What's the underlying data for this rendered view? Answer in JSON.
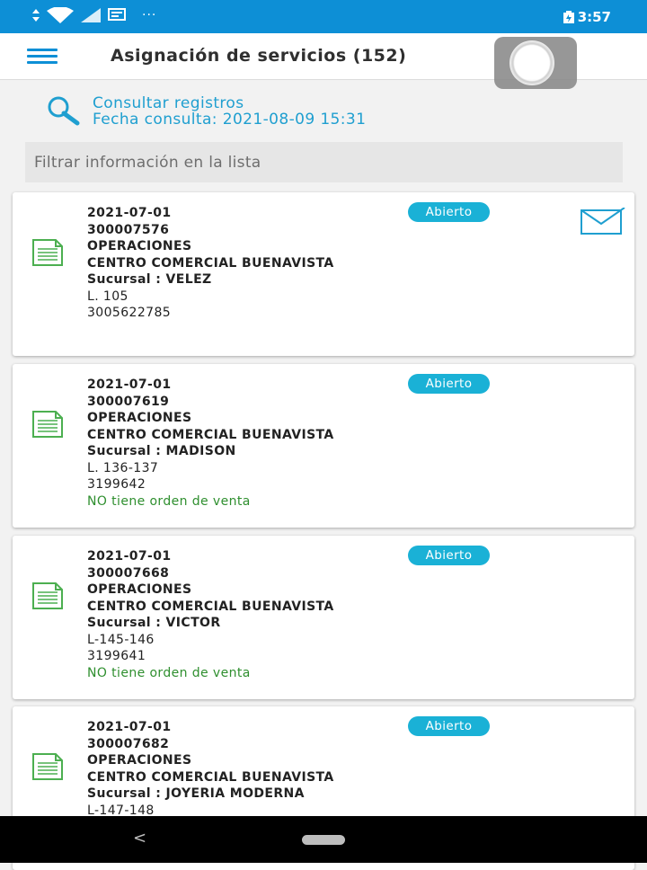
{
  "status_bar": {
    "time": "3:57",
    "overflow": "···"
  },
  "header": {
    "title": "Asignación de servicios (152)"
  },
  "consult": {
    "link": "Consultar registros",
    "date_line": "Fecha consulta: 2021-08-09 15:31"
  },
  "filter": {
    "placeholder": "Filtrar información en la lista",
    "value": ""
  },
  "cards": [
    {
      "date": "2021-07-01",
      "code": "300007576",
      "dept": "OPERACIONES",
      "place": "CENTRO COMERCIAL BUENAVISTA",
      "branch": "Sucursal : VELEZ",
      "local": "L. 105",
      "phone": "3005622785",
      "note": "",
      "status": "Abierto"
    },
    {
      "date": "2021-07-01",
      "code": "300007619",
      "dept": "OPERACIONES",
      "place": "CENTRO COMERCIAL BUENAVISTA",
      "branch": "Sucursal : MADISON",
      "local": "L. 136-137",
      "phone": "3199642",
      "note": "NO tiene orden de venta",
      "status": "Abierto"
    },
    {
      "date": "2021-07-01",
      "code": "300007668",
      "dept": "OPERACIONES",
      "place": "CENTRO COMERCIAL BUENAVISTA",
      "branch": "Sucursal : VICTOR",
      "local": "L-145-146",
      "phone": "3199641",
      "note": "NO tiene orden de venta",
      "status": "Abierto"
    },
    {
      "date": "2021-07-01",
      "code": "300007682",
      "dept": "OPERACIONES",
      "place": "CENTRO COMERCIAL BUENAVISTA",
      "branch": "Sucursal : JOYERIA MODERNA",
      "local": "L-147-148",
      "phone": "",
      "note": "",
      "status": "Abierto"
    }
  ],
  "nav": {
    "back": "<"
  },
  "colors": {
    "primary": "#0d8fd6",
    "badge": "#1ab1d6",
    "doc_icon": "#4caf50",
    "note_green": "#2f8f2f"
  },
  "icons": {
    "menu": "menu-icon",
    "search": "search-icon",
    "document": "document-icon",
    "mail": "mail-check-icon"
  }
}
